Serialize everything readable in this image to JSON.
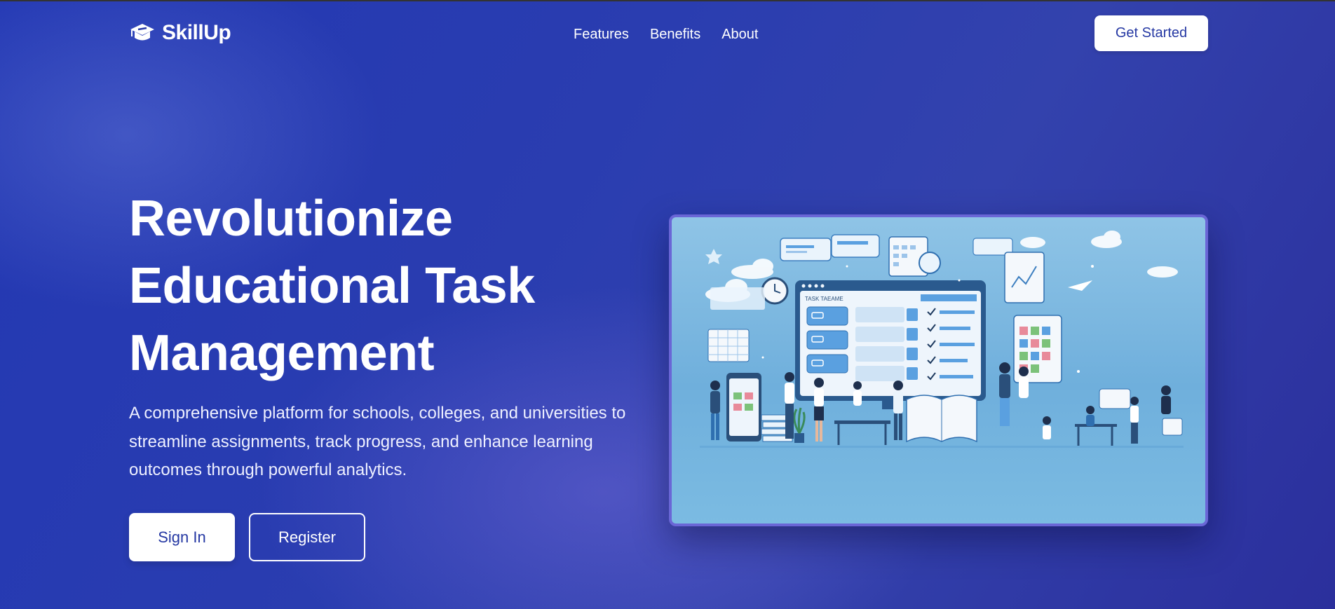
{
  "brand": {
    "name": "SkillUp",
    "logo_icon": "graduation-cap-icon"
  },
  "nav": {
    "links": [
      "Features",
      "Benefits",
      "About"
    ],
    "cta_label": "Get Started"
  },
  "hero": {
    "title": "Revolutionize Educational Task Management",
    "description": "A comprehensive platform for schools, colleges, and universities to streamline assignments, track progress, and enhance learning outcomes through powerful analytics.",
    "primary_button": "Sign In",
    "secondary_button": "Register"
  },
  "illustration": {
    "screen_title": "TASK TAEAME"
  },
  "colors": {
    "accent": "#2538a3",
    "background": "#2a3aa8",
    "illustration_border": "#6a66d6"
  }
}
